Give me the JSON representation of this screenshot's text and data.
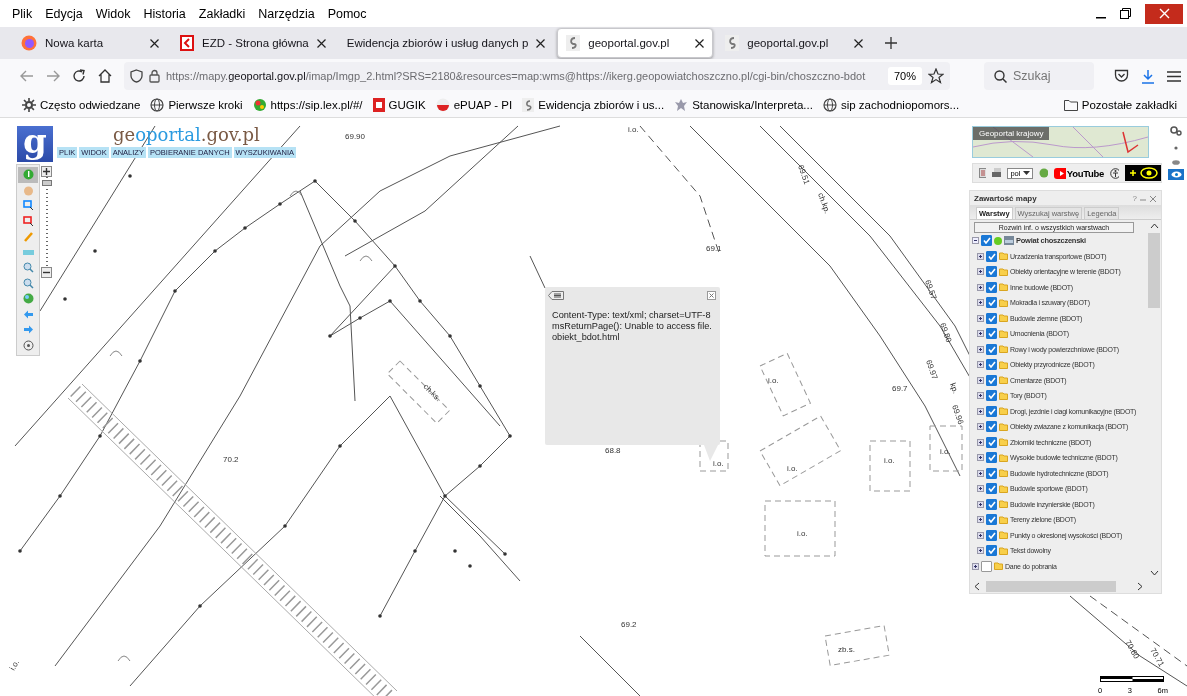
{
  "menu_bar": [
    "Plik",
    "Edycja",
    "Widok",
    "Historia",
    "Zakładki",
    "Narzędzia",
    "Pomoc"
  ],
  "tabs": [
    {
      "title": "Nowa karta",
      "selected": false
    },
    {
      "title": "EZD - Strona główna",
      "selected": false
    },
    {
      "title": "Ewidencja zbiorów i usług danych p",
      "selected": false
    },
    {
      "title": "geoportal.gov.pl",
      "selected": true
    },
    {
      "title": "geoportal.gov.pl",
      "selected": false
    }
  ],
  "url": {
    "scheme": "https://mapy.",
    "host": "geoportal.gov.pl",
    "path": "/imap/Imgp_2.html?SRS=2180&resources=map:wms@https://ikerg.geopowiatchoszczno.pl/cgi-bin/choszczno-bdot"
  },
  "zoom": "70%",
  "search": {
    "placeholder": "Szukaj"
  },
  "bookmarks": [
    "Często odwiedzane",
    "Pierwsze kroki",
    "https://sip.lex.pl/#/",
    "GUGIK",
    "ePUAP - PI",
    "Ewidencja zbiorów i us...",
    "Stanowiska/Interpreta...",
    "sip zachodniopomors..."
  ],
  "other_bookmarks": "Pozostałe zakładki",
  "app": {
    "logo_letter": "g",
    "title_parts": [
      "ge",
      "oportal",
      ".gov.pl"
    ],
    "menu": [
      "PLIK",
      "WIDOK",
      "ANALIZY",
      "POBIERANIE DANYCH",
      "WYSZUKIWANIA"
    ],
    "zoom_slider": {
      "level": 0.97
    },
    "tools": [
      {
        "selected": true
      },
      {
        "selected": false
      },
      {
        "selected": false
      },
      {
        "selected": false
      },
      {
        "selected": false
      },
      {
        "selected": false
      },
      {
        "selected": false
      },
      {
        "selected": false
      },
      {
        "selected": false
      },
      {
        "selected": false
      },
      {
        "selected": false
      },
      {
        "selected": false
      }
    ]
  },
  "map_labels": [
    "69.90",
    "i.o.",
    "69.51",
    "ch.kp.",
    "69.1",
    "69.57",
    "69.80",
    "69.97",
    "kp.",
    "69.7",
    "69.96",
    "i.o.",
    "ch.ks.",
    "i.o.",
    "i.o.",
    "i.o.",
    "i.o.",
    "i.o.",
    "70.2",
    "68.8",
    "69.2",
    "zb.s.",
    "70.80",
    "70.71",
    "i.o."
  ],
  "popup": {
    "lines": [
      "Content-Type: text/xml; charset=UTF-8",
      "msReturnPage(): Unable to access file.",
      "obiekt_bdot.html"
    ]
  },
  "overview": {
    "title": "Geoportal krajowy"
  },
  "language": "pol",
  "youtube": "YouTube",
  "panel": {
    "title": "Zawartość mapy",
    "help": "?",
    "tabs": [
      {
        "label": "Warstwy",
        "selected": true
      },
      {
        "label": "Wyszukaj warstwę",
        "selected": false
      },
      {
        "label": "Legenda",
        "selected": false
      }
    ],
    "expand_button": "Rozwiń inf. o wszystkich warstwach",
    "layers": [
      {
        "name": "Powiat choszczenski",
        "kind": "group",
        "checked": true,
        "expanded": true,
        "children": [
          {
            "name": "Urzadzenia transportowe (BDOT)",
            "kind": "folder",
            "checked": true,
            "expanded": false
          },
          {
            "name": "Obiekty orientacyjne w terenie (BDOT)",
            "kind": "folder",
            "checked": true,
            "expanded": false
          },
          {
            "name": "Inne budowle (BDOT)",
            "kind": "folder",
            "checked": true,
            "expanded": false
          },
          {
            "name": "Mokradla i szuwary (BDOT)",
            "kind": "folder",
            "checked": true,
            "expanded": false
          },
          {
            "name": "Budowle ziemne (BDOT)",
            "kind": "folder",
            "checked": true,
            "expanded": false
          },
          {
            "name": "Umocnienia (BDOT)",
            "kind": "folder",
            "checked": true,
            "expanded": false
          },
          {
            "name": "Rowy i wody powierzchniowe (BDOT)",
            "kind": "folder",
            "checked": true,
            "expanded": false
          },
          {
            "name": "Obiekty przyrodnicze (BDOT)",
            "kind": "folder",
            "checked": true,
            "expanded": false
          },
          {
            "name": "Cmentarze (BDOT)",
            "kind": "folder",
            "checked": true,
            "expanded": false
          },
          {
            "name": "Tory (BDOT)",
            "kind": "folder",
            "checked": true,
            "expanded": false
          },
          {
            "name": "Drogi, jezdnie i ciagi komunikacyjne (BDOT)",
            "kind": "folder",
            "checked": true,
            "expanded": false
          },
          {
            "name": "Obiekty zwiazane z komunikacja (BDOT)",
            "kind": "folder",
            "checked": true,
            "expanded": false
          },
          {
            "name": "Zbiorniki techniczne (BDOT)",
            "kind": "folder",
            "checked": true,
            "expanded": false
          },
          {
            "name": "Wysokie budowle techniczne (BDOT)",
            "kind": "folder",
            "checked": true,
            "expanded": false
          },
          {
            "name": "Budowle hydrotechniczne (BDOT)",
            "kind": "folder",
            "checked": true,
            "expanded": false
          },
          {
            "name": "Budowle sportowe (BDOT)",
            "kind": "folder",
            "checked": true,
            "expanded": false
          },
          {
            "name": "Budowle inzynierskie (BDOT)",
            "kind": "folder",
            "checked": true,
            "expanded": false
          },
          {
            "name": "Tereny zielone (BDOT)",
            "kind": "folder",
            "checked": true,
            "expanded": false
          },
          {
            "name": "Punkty o okreslonej wysokości (BDOT)",
            "kind": "folder",
            "checked": true,
            "expanded": false
          },
          {
            "name": "Tekst dowolny",
            "kind": "folder",
            "checked": true,
            "expanded": false
          }
        ]
      },
      {
        "name": "Dane do pobrania",
        "kind": "folder",
        "checked": false,
        "expanded": false
      }
    ]
  },
  "scale": [
    "0",
    "3",
    "6m"
  ]
}
